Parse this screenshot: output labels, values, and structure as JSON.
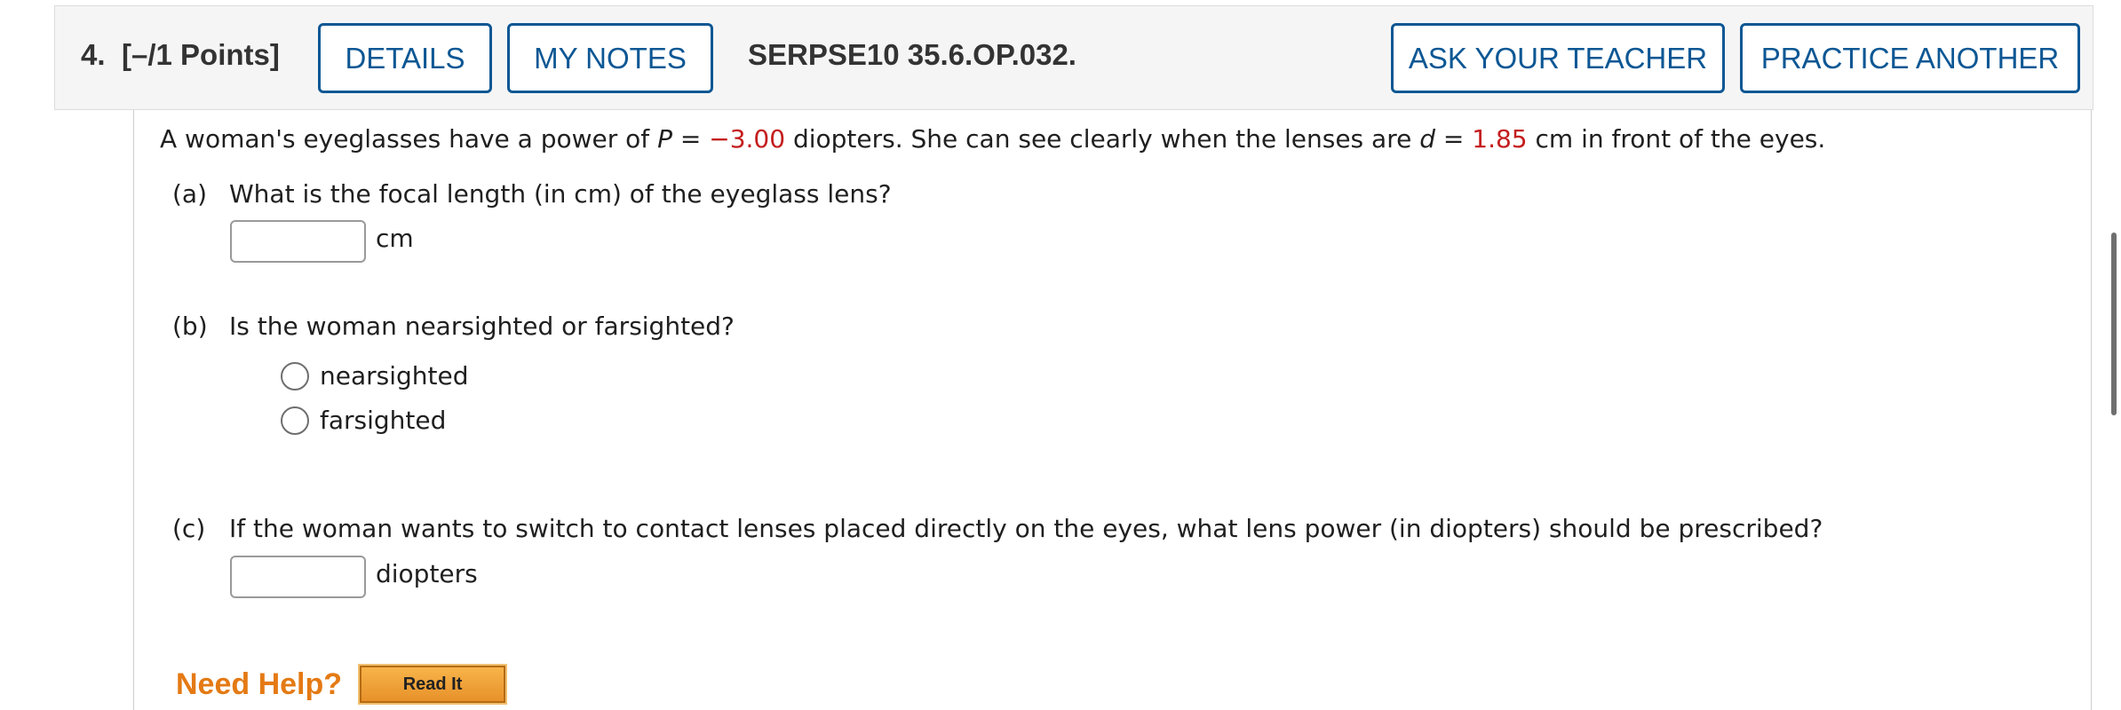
{
  "header": {
    "number": "4.",
    "points": "[–/1 Points]",
    "details_label": "DETAILS",
    "notes_label": "MY NOTES",
    "code": "SERPSE10 35.6.OP.032.",
    "ask_label": "ASK YOUR TEACHER",
    "practice_label": "PRACTICE ANOTHER"
  },
  "question": {
    "stem_1": "A woman's eyeglasses have a power of ",
    "var_p": "P",
    "eq_1": " = ",
    "power_value": "−3.00",
    "stem_2": " diopters. She can see clearly when the lenses are ",
    "var_d": "d",
    "eq_2": " = ",
    "distance_value": "1.85",
    "stem_3": " cm in front of the eyes."
  },
  "parts": {
    "a": {
      "letter": "(a)",
      "text": "What is the focal length (in cm) of the eyeglass lens?",
      "value": "",
      "unit": "cm"
    },
    "b": {
      "letter": "(b)",
      "text": "Is the woman nearsighted or farsighted?",
      "options": [
        "nearsighted",
        "farsighted"
      ]
    },
    "c": {
      "letter": "(c)",
      "text": "If the woman wants to switch to contact lenses placed directly on the eyes, what lens power (in diopters) should be prescribed?",
      "value": "",
      "unit": "diopters"
    }
  },
  "help": {
    "label": "Need Help?",
    "read_it": "Read It"
  },
  "colors": {
    "accent": "#0c5794",
    "red_value": "#c41e1e",
    "help_orange": "#e47a14"
  }
}
